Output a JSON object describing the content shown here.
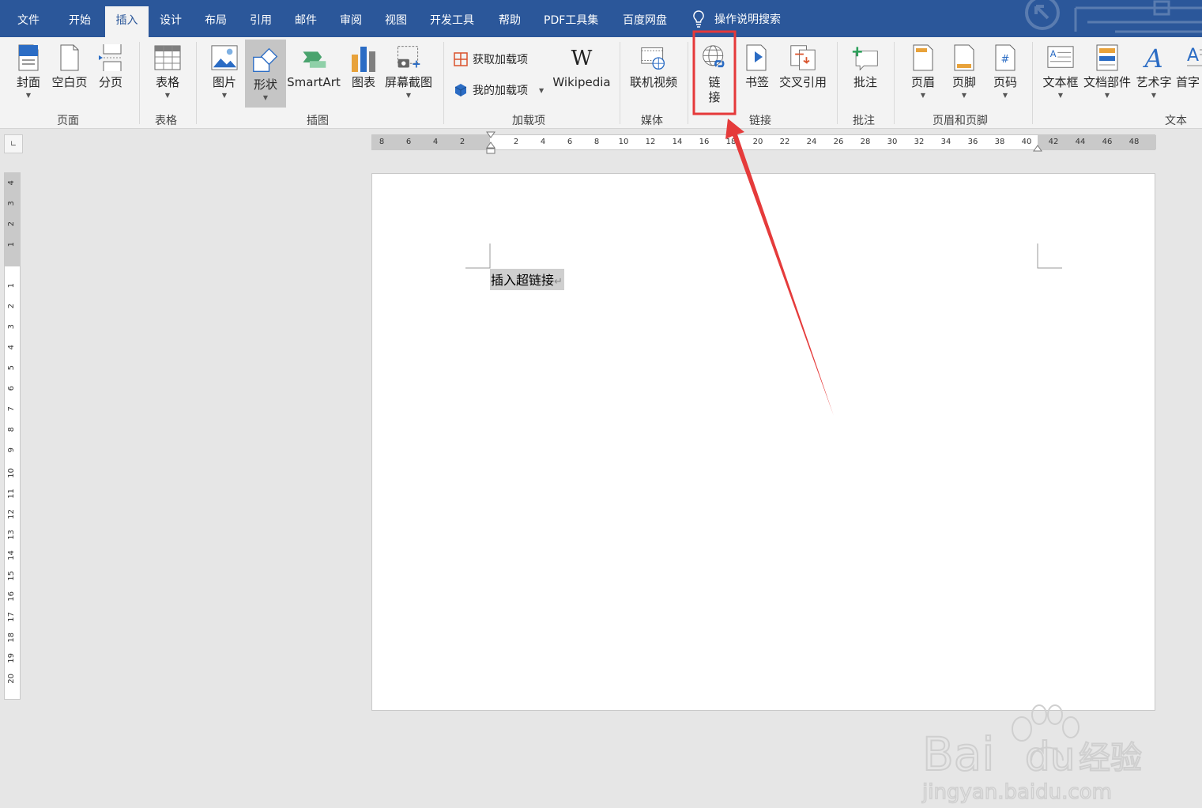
{
  "menu_tabs": [
    "文件",
    "开始",
    "插入",
    "设计",
    "布局",
    "引用",
    "邮件",
    "审阅",
    "视图",
    "开发工具",
    "帮助",
    "PDF工具集",
    "百度网盘"
  ],
  "active_tab": "插入",
  "tell_me": "操作说明搜索",
  "ribbon": {
    "pages_group": {
      "label": "页面",
      "cover": "封面",
      "blank": "空白页",
      "break": "分页"
    },
    "tables_group": {
      "label": "表格",
      "table": "表格"
    },
    "illustrations_group": {
      "label": "插图",
      "picture": "图片",
      "shapes": "形状",
      "smartart": "SmartArt",
      "chart": "图表",
      "screenshot": "屏幕截图"
    },
    "addins_group": {
      "label": "加载项",
      "get_addins": "获取加载项",
      "my_addins": "我的加载项",
      "wikipedia": "Wikipedia"
    },
    "media_group": {
      "label": "媒体",
      "online_video": "联机视频"
    },
    "links_group": {
      "label": "链接",
      "link_line1": "链",
      "link_line2": "接",
      "bookmark": "书签",
      "cross_ref": "交叉引用"
    },
    "comments_group": {
      "label": "批注",
      "comment": "批注"
    },
    "header_footer_group": {
      "label": "页眉和页脚",
      "header": "页眉",
      "footer": "页脚",
      "page_number": "页码"
    },
    "text_group": {
      "label": "文本",
      "textbox": "文本框",
      "quick_parts": "文档部件",
      "wordart": "艺术字",
      "dropcap": "首字"
    }
  },
  "ruler": {
    "horizontal_ticks": [
      "8",
      "6",
      "4",
      "2",
      "",
      "2",
      "4",
      "6",
      "8",
      "10",
      "12",
      "14",
      "16",
      "18",
      "20",
      "22",
      "24",
      "26",
      "28",
      "30",
      "32",
      "34",
      "36",
      "38",
      "40",
      "42",
      "44",
      "46",
      "48"
    ],
    "vertical_ticks": [
      "4",
      "3",
      "2",
      "1",
      "",
      "1",
      "2",
      "3",
      "4",
      "5",
      "6",
      "7",
      "8",
      "9",
      "10",
      "11",
      "12",
      "13",
      "14",
      "15",
      "16",
      "17",
      "18",
      "19",
      "20"
    ]
  },
  "document": {
    "text": "插入超链接",
    "paragraph_mark": "↵"
  },
  "watermark": {
    "brand_line1": "Bai",
    "brand_line2": "du",
    "brand_cn": "经验",
    "domain": "jingyan.baidu.com"
  },
  "colors": {
    "tab_bar": "#2b579a",
    "highlight_box": "#e5393a",
    "arrow": "#e53b3b"
  }
}
